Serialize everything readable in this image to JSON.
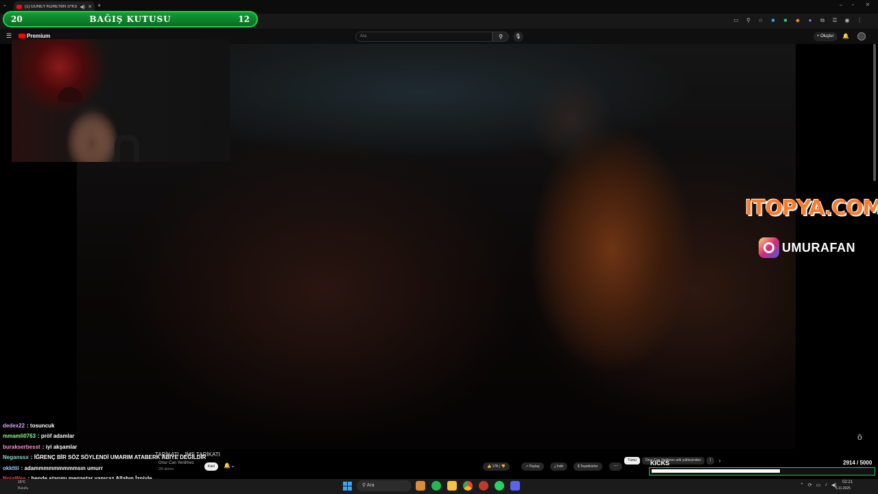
{
  "browser": {
    "tab_title": "(1) GÜNEY KORE'NİN S*KS",
    "new_tab": "+",
    "menu_icon": "⌄",
    "window": {
      "minimize": "–",
      "maximize": "▫",
      "close": "✕"
    }
  },
  "donation": {
    "left_value": "20",
    "title": "BAĞIŞ KUTUSU",
    "right_value": "12"
  },
  "youtube": {
    "logo": "Premium",
    "search_placeholder": "Ara",
    "create_label": "Oluştur",
    "video_title": "TARİKATI - JMS TARİKATI",
    "channel_name": "Onur Can Yenilmez",
    "subscribers": "2M abone",
    "join_label": "Katıl",
    "likes": "17B",
    "share_label": "Paylaş",
    "download_label": "İndir",
    "thanks_label": "Teşekkürler",
    "filters": [
      "Tümü",
      "Onur Can Yenilmez adlı yükleyiciden",
      "İ"
    ]
  },
  "overlays": {
    "sponsor": "ITOPYA.COM",
    "instagram_handle": "UMURAFAN"
  },
  "chat": [
    {
      "user": "dedex22",
      "color": "#d8a6ff",
      "message": "tosuncuk"
    },
    {
      "user": "mmamli0763",
      "color": "#8cff8c",
      "message": "pröf adamlar"
    },
    {
      "user": "burakserbesst",
      "color": "#ff8fd0",
      "message": "iyi akşamlar"
    },
    {
      "user": "Neganssx",
      "color": "#7fe0c8",
      "message": "İĞRENÇ BİR SÖZ SÖYLENDİ UMARIM ATABERK ABİYE DEĞİLDİR"
    },
    {
      "user": "okkttii",
      "color": "#9fd1ff",
      "message": "adammmmmmmmmsın umurr"
    },
    {
      "user": "NojaWes",
      "color": "#ff4040",
      "message": "bende starımı megastar yapıcaz Allahın İzniyle"
    }
  ],
  "kicks": {
    "label": "KICKS",
    "current": "2914",
    "goal": "/ 5000",
    "progress": 0.58
  },
  "taskbar": {
    "weather_temp": "15°C",
    "weather_desc": "Bulutlu",
    "search_placeholder": "Ara",
    "time": "02:21",
    "date": "5.11.2025"
  },
  "colors": {
    "donation_green": "#1bd64a",
    "sponsor_orange": "#ff7a2a",
    "youtube_red": "#ff0000"
  }
}
